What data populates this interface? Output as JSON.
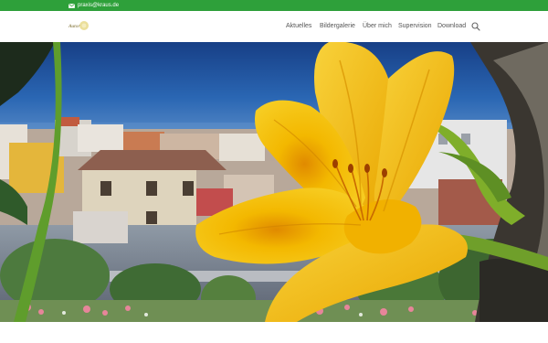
{
  "topbar": {
    "email": "praxis@kraus.de",
    "mail_icon": "envelope-icon",
    "bg_color": "#2ea03a"
  },
  "header": {
    "logo_text": "Autor"
  },
  "nav": {
    "items": [
      {
        "label": "Aktuelles"
      },
      {
        "label": "Bildergalerie"
      },
      {
        "label": "Über mich"
      },
      {
        "label": "Supervision"
      },
      {
        "label": "Download"
      }
    ],
    "search_icon": "search-icon"
  },
  "hero": {
    "image": "yellow-lily-over-town-and-sea"
  }
}
